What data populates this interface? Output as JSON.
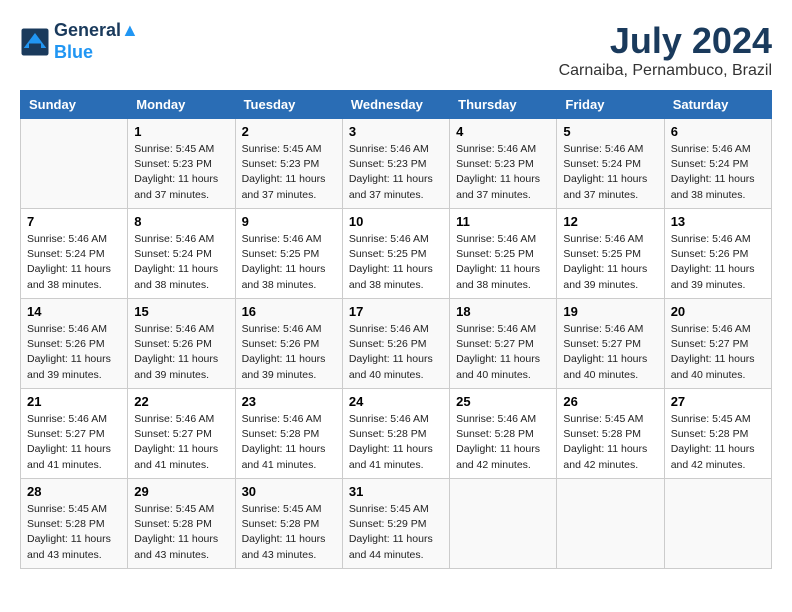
{
  "header": {
    "logo_line1": "General",
    "logo_line2": "Blue",
    "month": "July 2024",
    "location": "Carnaiba, Pernambuco, Brazil"
  },
  "days_of_week": [
    "Sunday",
    "Monday",
    "Tuesday",
    "Wednesday",
    "Thursday",
    "Friday",
    "Saturday"
  ],
  "weeks": [
    [
      {
        "day": "",
        "info": ""
      },
      {
        "day": "1",
        "info": "Sunrise: 5:45 AM\nSunset: 5:23 PM\nDaylight: 11 hours\nand 37 minutes."
      },
      {
        "day": "2",
        "info": "Sunrise: 5:45 AM\nSunset: 5:23 PM\nDaylight: 11 hours\nand 37 minutes."
      },
      {
        "day": "3",
        "info": "Sunrise: 5:46 AM\nSunset: 5:23 PM\nDaylight: 11 hours\nand 37 minutes."
      },
      {
        "day": "4",
        "info": "Sunrise: 5:46 AM\nSunset: 5:23 PM\nDaylight: 11 hours\nand 37 minutes."
      },
      {
        "day": "5",
        "info": "Sunrise: 5:46 AM\nSunset: 5:24 PM\nDaylight: 11 hours\nand 37 minutes."
      },
      {
        "day": "6",
        "info": "Sunrise: 5:46 AM\nSunset: 5:24 PM\nDaylight: 11 hours\nand 38 minutes."
      }
    ],
    [
      {
        "day": "7",
        "info": "Sunrise: 5:46 AM\nSunset: 5:24 PM\nDaylight: 11 hours\nand 38 minutes."
      },
      {
        "day": "8",
        "info": "Sunrise: 5:46 AM\nSunset: 5:24 PM\nDaylight: 11 hours\nand 38 minutes."
      },
      {
        "day": "9",
        "info": "Sunrise: 5:46 AM\nSunset: 5:25 PM\nDaylight: 11 hours\nand 38 minutes."
      },
      {
        "day": "10",
        "info": "Sunrise: 5:46 AM\nSunset: 5:25 PM\nDaylight: 11 hours\nand 38 minutes."
      },
      {
        "day": "11",
        "info": "Sunrise: 5:46 AM\nSunset: 5:25 PM\nDaylight: 11 hours\nand 38 minutes."
      },
      {
        "day": "12",
        "info": "Sunrise: 5:46 AM\nSunset: 5:25 PM\nDaylight: 11 hours\nand 39 minutes."
      },
      {
        "day": "13",
        "info": "Sunrise: 5:46 AM\nSunset: 5:26 PM\nDaylight: 11 hours\nand 39 minutes."
      }
    ],
    [
      {
        "day": "14",
        "info": "Sunrise: 5:46 AM\nSunset: 5:26 PM\nDaylight: 11 hours\nand 39 minutes."
      },
      {
        "day": "15",
        "info": "Sunrise: 5:46 AM\nSunset: 5:26 PM\nDaylight: 11 hours\nand 39 minutes."
      },
      {
        "day": "16",
        "info": "Sunrise: 5:46 AM\nSunset: 5:26 PM\nDaylight: 11 hours\nand 39 minutes."
      },
      {
        "day": "17",
        "info": "Sunrise: 5:46 AM\nSunset: 5:26 PM\nDaylight: 11 hours\nand 40 minutes."
      },
      {
        "day": "18",
        "info": "Sunrise: 5:46 AM\nSunset: 5:27 PM\nDaylight: 11 hours\nand 40 minutes."
      },
      {
        "day": "19",
        "info": "Sunrise: 5:46 AM\nSunset: 5:27 PM\nDaylight: 11 hours\nand 40 minutes."
      },
      {
        "day": "20",
        "info": "Sunrise: 5:46 AM\nSunset: 5:27 PM\nDaylight: 11 hours\nand 40 minutes."
      }
    ],
    [
      {
        "day": "21",
        "info": "Sunrise: 5:46 AM\nSunset: 5:27 PM\nDaylight: 11 hours\nand 41 minutes."
      },
      {
        "day": "22",
        "info": "Sunrise: 5:46 AM\nSunset: 5:27 PM\nDaylight: 11 hours\nand 41 minutes."
      },
      {
        "day": "23",
        "info": "Sunrise: 5:46 AM\nSunset: 5:28 PM\nDaylight: 11 hours\nand 41 minutes."
      },
      {
        "day": "24",
        "info": "Sunrise: 5:46 AM\nSunset: 5:28 PM\nDaylight: 11 hours\nand 41 minutes."
      },
      {
        "day": "25",
        "info": "Sunrise: 5:46 AM\nSunset: 5:28 PM\nDaylight: 11 hours\nand 42 minutes."
      },
      {
        "day": "26",
        "info": "Sunrise: 5:45 AM\nSunset: 5:28 PM\nDaylight: 11 hours\nand 42 minutes."
      },
      {
        "day": "27",
        "info": "Sunrise: 5:45 AM\nSunset: 5:28 PM\nDaylight: 11 hours\nand 42 minutes."
      }
    ],
    [
      {
        "day": "28",
        "info": "Sunrise: 5:45 AM\nSunset: 5:28 PM\nDaylight: 11 hours\nand 43 minutes."
      },
      {
        "day": "29",
        "info": "Sunrise: 5:45 AM\nSunset: 5:28 PM\nDaylight: 11 hours\nand 43 minutes."
      },
      {
        "day": "30",
        "info": "Sunrise: 5:45 AM\nSunset: 5:28 PM\nDaylight: 11 hours\nand 43 minutes."
      },
      {
        "day": "31",
        "info": "Sunrise: 5:45 AM\nSunset: 5:29 PM\nDaylight: 11 hours\nand 44 minutes."
      },
      {
        "day": "",
        "info": ""
      },
      {
        "day": "",
        "info": ""
      },
      {
        "day": "",
        "info": ""
      }
    ]
  ]
}
